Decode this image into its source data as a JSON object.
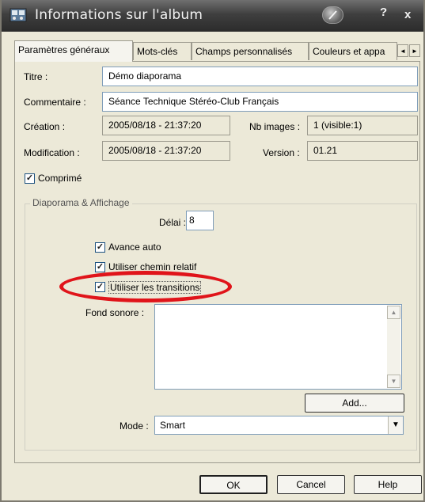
{
  "window": {
    "title": "Informations sur l'album",
    "help_glyph": "?",
    "close_glyph": "x"
  },
  "tabs": [
    {
      "label": "Paramètres généraux",
      "active": true
    },
    {
      "label": "Mots-clés",
      "active": false
    },
    {
      "label": "Champs personnalisés",
      "active": false
    },
    {
      "label": "Couleurs et appa",
      "active": false
    }
  ],
  "tab_scroll": {
    "left": "◄",
    "right": "►"
  },
  "general": {
    "titre_label": "Titre :",
    "titre_value": "Démo diaporama",
    "commentaire_label": "Commentaire :",
    "commentaire_value": "Séance Technique Stéréo-Club Français",
    "creation_label": "Création :",
    "creation_value": "2005/08/18 - 21:37:20",
    "nb_images_label": "Nb images :",
    "nb_images_value": "1 (visible:1)",
    "modification_label": "Modification :",
    "modification_value": "2005/08/18 - 21:37:20",
    "version_label": "Version :",
    "version_value": "01.21",
    "comprime_label": "Comprimé",
    "comprime_checked": true
  },
  "slideshow": {
    "group_title": "Diaporama & Affichage",
    "delai_label": "Délai :",
    "delai_value": "8",
    "avance_auto_label": "Avance auto",
    "chemin_relatif_label": "Utiliser chemin relatif",
    "transitions_label": "Utiliser les transitions",
    "checkmark": "✓",
    "fond_sonore_label": "Fond sonore :",
    "add_label": "Add...",
    "mode_label": "Mode :",
    "mode_value": "Smart"
  },
  "footer": {
    "ok_label": "OK",
    "cancel_label": "Cancel",
    "help_label": "Help"
  },
  "colors": {
    "highlight_ellipse": "#e0141a",
    "dialog_bg": "#ece9d8"
  }
}
